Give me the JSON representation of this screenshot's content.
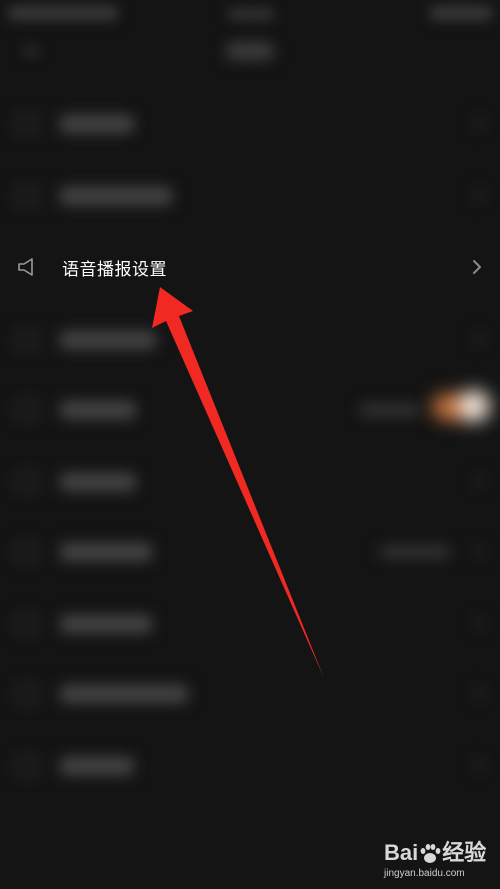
{
  "screen": {
    "background": "#141414"
  },
  "focused_item": {
    "label": "语音播报设置",
    "icon": "speaker-icon",
    "trailing_icon": "chevron-right-icon"
  },
  "annotation": {
    "type": "arrow",
    "color": "#f02a22",
    "points_to": "focused_item"
  },
  "other_items": {
    "blurred": true,
    "toggle_color": "#c8733a"
  },
  "watermark": {
    "brand": "Bai",
    "brand_suffix": "经验",
    "url": "jingyan.baidu.com"
  }
}
